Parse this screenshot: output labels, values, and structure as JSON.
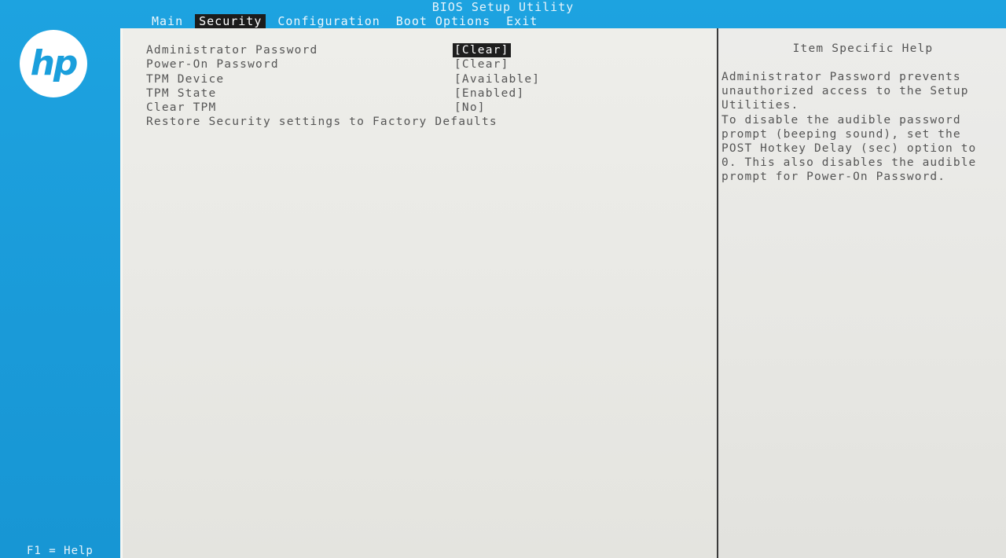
{
  "window": {
    "title": "BIOS Setup Utility"
  },
  "menu": {
    "items": [
      {
        "label": "Main",
        "active": false
      },
      {
        "label": "Security",
        "active": true
      },
      {
        "label": "Configuration",
        "active": false
      },
      {
        "label": "Boot Options",
        "active": false
      },
      {
        "label": "Exit",
        "active": false
      }
    ]
  },
  "logo": {
    "text": "hp",
    "icon": "hp-logo",
    "color": "#ffffff"
  },
  "settings": [
    {
      "label": "Administrator Password",
      "value": "[Clear]",
      "selected": true
    },
    {
      "label": "Power-On Password",
      "value": "[Clear]",
      "selected": false
    },
    {
      "label": "TPM Device",
      "value": "[Available]",
      "selected": false
    },
    {
      "label": "TPM State",
      "value": "[Enabled]",
      "selected": false
    },
    {
      "label": "Clear TPM",
      "value": "[No]",
      "selected": false
    },
    {
      "label": "Restore Security settings to Factory Defaults",
      "value": "",
      "selected": false
    }
  ],
  "help": {
    "title": "Item Specific Help",
    "lines": [
      "Administrator Password prevents",
      "unauthorized access to the Setup",
      "Utilities.",
      "To disable the audible password",
      "prompt (beeping sound), set the",
      "POST Hotkey Delay (sec) option to",
      "0. This also disables the audible",
      "prompt for Power-On Password."
    ]
  },
  "footer": {
    "hint": "F1 = Help"
  },
  "colors": {
    "background": "#1a9fdc",
    "panel": "#eaeae6",
    "text": "#555555",
    "highlight": "#1e1e1e"
  }
}
